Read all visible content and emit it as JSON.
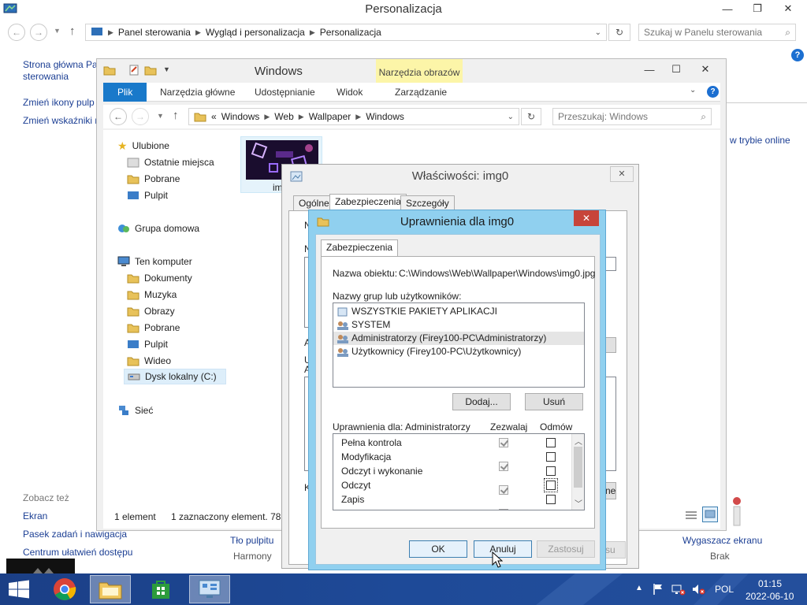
{
  "control_panel": {
    "title": "Personalizacja",
    "breadcrumb": [
      "Panel sterowania",
      "Wygląd i personalizacja",
      "Personalizacja"
    ],
    "search_placeholder": "Szukaj w Panelu sterowania",
    "left_links": [
      "Strona główna Pa",
      "sterowania",
      "Zmień ikony pulp",
      "Zmień wskaźniki m"
    ],
    "see_also": "Zobacz też",
    "see_also_links": [
      "Ekran",
      "Pasek zadań i nawigacja",
      "Centrum ułatwień dostępu"
    ],
    "online_link": "w trybie online",
    "bottom_items": [
      {
        "label": "Tło pulpitu",
        "sub": "Harmony"
      },
      {
        "label": "Wygaszacz ekranu",
        "sub": "Brak"
      }
    ]
  },
  "explorer": {
    "title": "Windows",
    "tools_tab": "Narzędzia obrazów",
    "ribbon_tabs": [
      "Plik",
      "Narzędzia główne",
      "Udostępnianie",
      "Widok",
      "Zarządzanie"
    ],
    "path": [
      "Windows",
      "Web",
      "Wallpaper",
      "Windows"
    ],
    "path_prefix": "«",
    "search_placeholder": "Przeszukaj: Windows",
    "tree": {
      "favorites": "Ulubione",
      "favorites_items": [
        "Ostatnie miejsca",
        "Pobrane",
        "Pulpit"
      ],
      "homegroup": "Grupa domowa",
      "computer": "Ten komputer",
      "computer_items": [
        "Dokumenty",
        "Muzyka",
        "Obrazy",
        "Pobrane",
        "Pulpit",
        "Wideo",
        "Dysk lokalny (C:)"
      ],
      "network": "Sieć"
    },
    "file_label": "img",
    "status_count": "1 element",
    "status_selected": "1 zaznaczony element. 78,5"
  },
  "properties": {
    "title": "Właściwości: img0",
    "tabs": [
      "Ogólne",
      "Zabezpieczenia",
      "Szczegóły"
    ],
    "hidden_fragments": [
      "N",
      "N",
      "A",
      "U",
      "A",
      "K"
    ],
    "hidden_button": "ne",
    "hidden_button2": "su"
  },
  "permissions": {
    "title": "Uprawnienia dla img0",
    "tab": "Zabezpieczenia",
    "object_label": "Nazwa obiektu:",
    "object_value": "C:\\Windows\\Web\\Wallpaper\\Windows\\img0.jpg",
    "groups_label": "Nazwy grup lub użytkowników:",
    "groups": [
      "WSZYSTKIE PAKIETY APLIKACJI",
      "SYSTEM",
      "Administratorzy (Firey100-PC\\Administratorzy)",
      "Użytkownicy (Firey100-PC\\Użytkownicy)"
    ],
    "add_button": "Dodaj...",
    "remove_button": "Usuń",
    "perm_for_label": "Uprawnienia dla: Administratorzy",
    "allow_header": "Zezwalaj",
    "deny_header": "Odmów",
    "perm_rows": [
      "Pełna kontrola",
      "Modyfikacja",
      "Odczyt i wykonanie",
      "Odczyt",
      "Zapis"
    ],
    "ok_button": "OK",
    "cancel_button": "Anuluj",
    "apply_button": "Zastosuj"
  },
  "taskbar": {
    "language": "POL",
    "time": "01:15",
    "date": "2022-06-10"
  },
  "colors": {
    "ribbon_file": "#1979ca",
    "tools_tab_bg": "#fcf5a8",
    "dialog_frame": "#90d0ef",
    "close_red": "#c7443a",
    "taskbar": "#1e4a98"
  }
}
